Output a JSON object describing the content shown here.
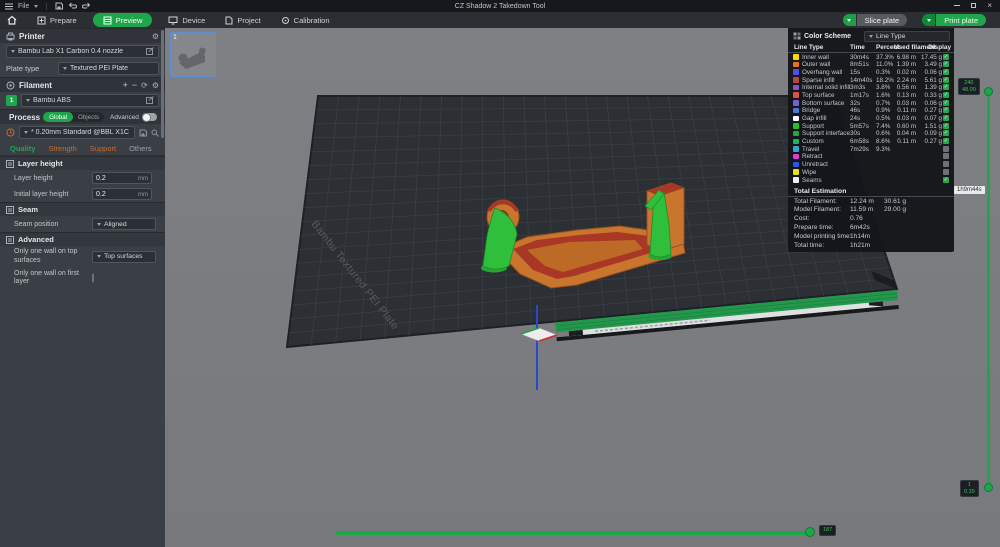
{
  "titlebar": {
    "file_label": "File",
    "title": "CZ Shadow 2 Takedown Tool"
  },
  "tabbar": {
    "tabs": [
      {
        "label": "Prepare"
      },
      {
        "label": "Preview"
      },
      {
        "label": "Device"
      },
      {
        "label": "Project"
      },
      {
        "label": "Calibration"
      }
    ],
    "active_tab": "Preview",
    "slice_button_label": "Slice plate",
    "print_button_label": "Print plate"
  },
  "sidebar": {
    "printer": {
      "title": "Printer",
      "preset": "Bambu Lab X1 Carbon 0.4 nozzle",
      "plate_type_label": "Plate type",
      "plate_type_value": "Textured PEI Plate"
    },
    "filament": {
      "title": "Filament",
      "slot_number": "1",
      "preset": "Bambu ABS"
    },
    "process": {
      "title": "Process",
      "scope_global": "Global",
      "scope_objects": "Objects",
      "advanced_label": "Advanced",
      "preset": "* 0.20mm Standard @BBL X1C"
    },
    "tabs": [
      {
        "label": "Quality",
        "color": "#22A454"
      },
      {
        "label": "Strength",
        "color": "#D26A2C"
      },
      {
        "label": "Support",
        "color": "#D26A2C"
      },
      {
        "label": "Others",
        "color": "#9BA1A7"
      }
    ],
    "sections": [
      {
        "title": "Layer height",
        "rows": [
          {
            "label": "Layer height",
            "type": "input",
            "value": "0.2",
            "unit": "mm"
          },
          {
            "label": "Initial layer height",
            "type": "input",
            "value": "0.2",
            "unit": "mm"
          }
        ]
      },
      {
        "title": "Seam",
        "rows": [
          {
            "label": "Seam position",
            "type": "select",
            "value": "Aligned"
          }
        ]
      },
      {
        "title": "Advanced",
        "rows": [
          {
            "label": "Only one wall on top surfaces",
            "type": "select",
            "value": "Top surfaces"
          },
          {
            "label": "Only one wall on first layer",
            "type": "checkbox",
            "checked": false
          }
        ]
      }
    ]
  },
  "legend": {
    "title": "Color Scheme",
    "view_selector": "Line Type",
    "columns": [
      "Line Type",
      "Time",
      "Percent",
      "Used filament",
      "Display"
    ],
    "rows": [
      {
        "name": "Inner wall",
        "color": "#FFD800",
        "time": "30m4s",
        "percent": "37.3%",
        "filament_m": "6.98 m",
        "filament_g": "17.45 g",
        "display": true
      },
      {
        "name": "Outer wall",
        "color": "#ED7020",
        "time": "8m51s",
        "percent": "11.0%",
        "filament_m": "1.39 m",
        "filament_g": "3.49 g",
        "display": true
      },
      {
        "name": "Overhang wall",
        "color": "#4F51E8",
        "time": "15s",
        "percent": "0.3%",
        "filament_m": "0.02 m",
        "filament_g": "0.06 g",
        "display": true
      },
      {
        "name": "Sparse infill",
        "color": "#B34A3F",
        "time": "14m40s",
        "percent": "18.2%",
        "filament_m": "2.24 m",
        "filament_g": "5.61 g",
        "display": true
      },
      {
        "name": "Internal solid infill",
        "color": "#9150C4",
        "time": "3m3s",
        "percent": "3.8%",
        "filament_m": "0.56 m",
        "filament_g": "1.39 g",
        "display": true
      },
      {
        "name": "Top surface",
        "color": "#DE5042",
        "time": "1m17s",
        "percent": "1.6%",
        "filament_m": "0.13 m",
        "filament_g": "0.33 g",
        "display": true
      },
      {
        "name": "Bottom surface",
        "color": "#7A5FD0",
        "time": "32s",
        "percent": "0.7%",
        "filament_m": "0.03 m",
        "filament_g": "0.06 g",
        "display": true
      },
      {
        "name": "Bridge",
        "color": "#4A78D8",
        "time": "46s",
        "percent": "0.9%",
        "filament_m": "0.11 m",
        "filament_g": "0.27 g",
        "display": true
      },
      {
        "name": "Gap infill",
        "color": "#FFFFFF",
        "time": "24s",
        "percent": "0.5%",
        "filament_m": "0.03 m",
        "filament_g": "0.07 g",
        "display": true
      },
      {
        "name": "Support",
        "color": "#25C223",
        "time": "5m57s",
        "percent": "7.4%",
        "filament_m": "0.60 m",
        "filament_g": "1.51 g",
        "display": true
      },
      {
        "name": "Support interface",
        "color": "#2F9E44",
        "time": "30s",
        "percent": "0.6%",
        "filament_m": "0.04 m",
        "filament_g": "0.09 g",
        "display": true
      },
      {
        "name": "Custom",
        "color": "#27AE60",
        "time": "6m58s",
        "percent": "8.6%",
        "filament_m": "0.11 m",
        "filament_g": "0.27 g",
        "display": true
      },
      {
        "name": "Travel",
        "color": "#38A5C8",
        "time": "7m29s",
        "percent": "9.3%",
        "filament_m": "",
        "filament_g": "",
        "display": false
      },
      {
        "name": "Retract",
        "color": "#DC3ECF",
        "time": "",
        "percent": "",
        "filament_m": "",
        "filament_g": "",
        "display": false
      },
      {
        "name": "Unretract",
        "color": "#2F54E8",
        "time": "",
        "percent": "",
        "filament_m": "",
        "filament_g": "",
        "display": false
      },
      {
        "name": "Wipe",
        "color": "#E7E213",
        "time": "",
        "percent": "",
        "filament_m": "",
        "filament_g": "",
        "display": false
      },
      {
        "name": "Seams",
        "color": "#EFEFEF",
        "time": "",
        "percent": "",
        "filament_m": "",
        "filament_g": "",
        "display": true
      }
    ],
    "total_estimation": {
      "title": "Total Estimation",
      "rows": [
        {
          "label": "Total Filament:",
          "value1": "12.24 m",
          "value2": "30.61 g"
        },
        {
          "label": "Model Filament:",
          "value1": "11.59 m",
          "value2": "29.00 g"
        },
        {
          "label": "Cost:",
          "value1": "0.76",
          "value2": ""
        },
        {
          "label": "Prepare time:",
          "value1": "6m42s",
          "value2": ""
        },
        {
          "label": "Model printing time:",
          "value1": "1h14m",
          "value2": ""
        },
        {
          "label": "Total time:",
          "value1": "1h21m",
          "value2": ""
        }
      ]
    }
  },
  "viewport": {
    "plate_thumbnail_number": "1",
    "plate_label": "Bambu Textured PEI Plate",
    "layer_slider": {
      "top_value": "240",
      "top_height_mm": "48.00",
      "time_tooltip": "1h9m44s",
      "bottom_value": "1",
      "bottom_height_mm": "0.20"
    },
    "step_slider_value": "187"
  },
  "colors": {
    "accent_green": "#1EA64A",
    "support_green": "#2FBF3A",
    "model_orange": "#C9752E",
    "model_top_red": "#A83825"
  }
}
